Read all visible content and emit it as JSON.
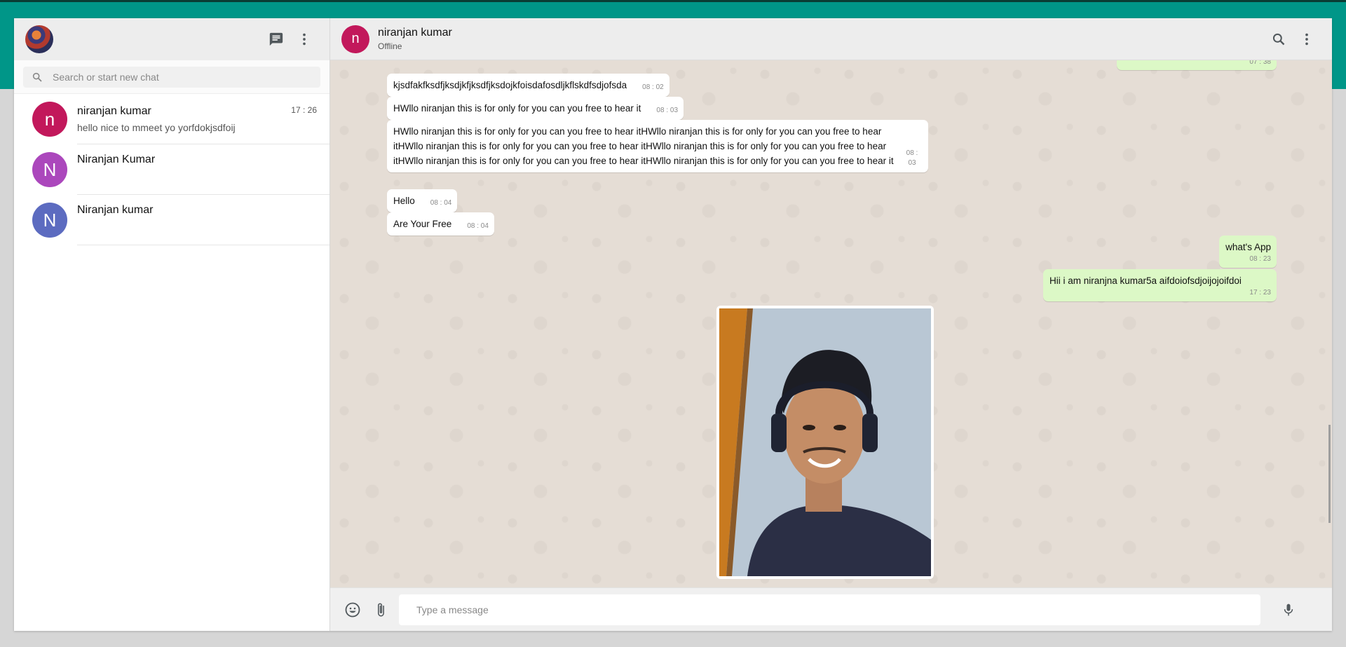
{
  "sidebar": {
    "search": {
      "placeholder": "Search or start new chat"
    },
    "icons": [
      "new-chat-icon",
      "menu-icon",
      "search-icon"
    ],
    "chats": [
      {
        "initial": "n",
        "name": "niranjan kumar",
        "preview": "hello nice to mmeet yo yorfdokjsdfoij",
        "time": "17 : 26",
        "color": "#c2185b"
      },
      {
        "initial": "N",
        "name": "Niranjan Kumar",
        "preview": "",
        "time": "",
        "color": "#ab47bc"
      },
      {
        "initial": "N",
        "name": "Niranjan kumar",
        "preview": "",
        "time": "",
        "color": "#5c6bc0"
      }
    ]
  },
  "conversation": {
    "contact": {
      "initial": "n",
      "name": "niranjan kumar",
      "status": "Offline"
    },
    "messages": [
      {
        "dir": "out",
        "text": "",
        "time": "07 : 38"
      },
      {
        "dir": "in",
        "text": "kjsdfakfksdfjksdjkfjksdfjksdojkfoisdafosdljkflskdfsdjofsda",
        "time": "08 : 02"
      },
      {
        "dir": "in",
        "text": "HWllo niranjan this is for only for you can you free to hear it",
        "time": "08 : 03"
      },
      {
        "dir": "in",
        "text": "HWllo niranjan this is for only for you can you free to hear itHWllo niranjan this is for only for you can you free to hear itHWllo niranjan this is for only for you can you free to hear itHWllo niranjan this is for only for you can you free to hear itHWllo niranjan this is for only for you can you free to hear itHWllo niranjan this is for only for you can you free to hear it",
        "time": "08 : 03"
      },
      {
        "dir": "in",
        "text": "Hello",
        "time": "08 : 04"
      },
      {
        "dir": "in",
        "text": "Are Your Free",
        "time": "08 : 04"
      },
      {
        "dir": "out",
        "text": "what's App",
        "time": "08 : 23"
      },
      {
        "dir": "out",
        "text": "Hii i am niranjna kumar5a aifdoiofsdjoijojoifdoi",
        "time": "17 : 23"
      },
      {
        "dir": "in",
        "type": "image",
        "alt": "photo",
        "time": ""
      }
    ],
    "input": {
      "placeholder": "Type a message"
    },
    "icons": [
      "search-icon",
      "menu-icon",
      "emoji-icon",
      "attach-icon",
      "mic-icon"
    ]
  },
  "colors": {
    "accent": "#009688",
    "outgoing_bubble": "#dcf8c6",
    "incoming_bubble": "#ffffff",
    "chat_bg": "#e5ddd5"
  }
}
